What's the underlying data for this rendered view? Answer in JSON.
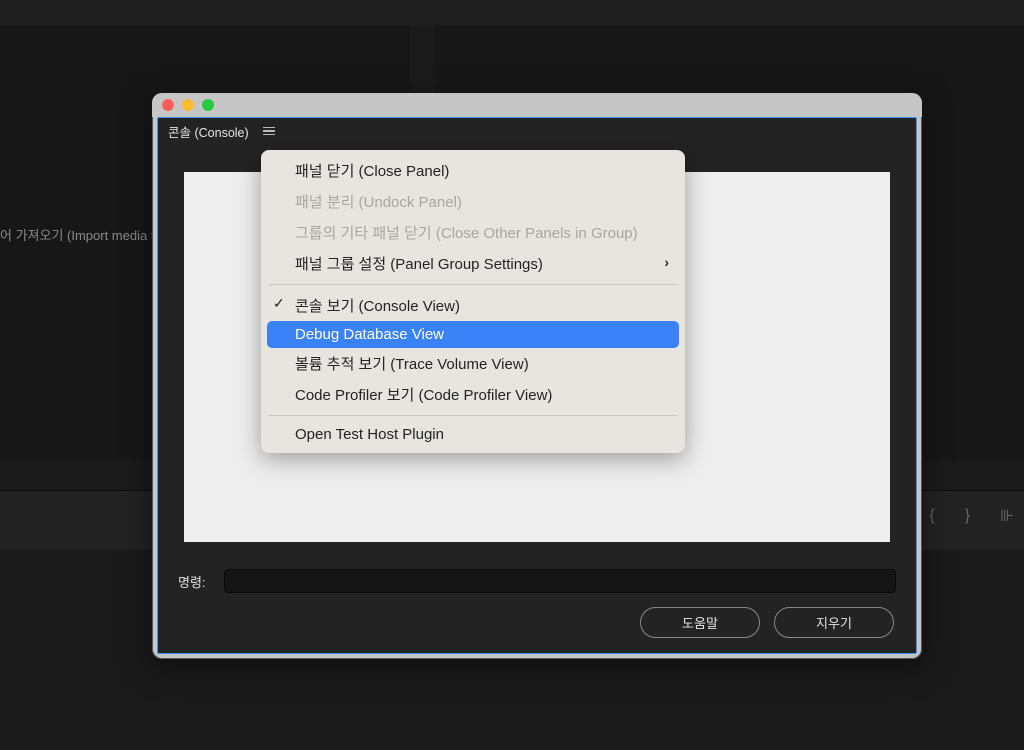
{
  "background": {
    "import_text": "어 가져오기 (Import media to",
    "icons": {
      "brace_open": "{",
      "brace_close": "}",
      "marker": "⊪"
    }
  },
  "window": {
    "tab_title": "콘솔 (Console)",
    "cmd_label": "명령:",
    "buttons": {
      "help": "도움말",
      "clear": "지우기"
    }
  },
  "menu": {
    "items": [
      {
        "id": "close-panel",
        "label": "패널 닫기 (Close Panel)",
        "disabled": false,
        "checked": false,
        "submenu": false,
        "highlight": false
      },
      {
        "id": "undock-panel",
        "label": "패널 분리 (Undock Panel)",
        "disabled": true,
        "checked": false,
        "submenu": false,
        "highlight": false
      },
      {
        "id": "close-other",
        "label": "그룹의 기타 패널 닫기 (Close Other Panels in Group)",
        "disabled": true,
        "checked": false,
        "submenu": false,
        "highlight": false
      },
      {
        "id": "panel-group",
        "label": "패널 그룹 설정 (Panel Group Settings)",
        "disabled": false,
        "checked": false,
        "submenu": true,
        "highlight": false
      },
      {
        "id": "sep1",
        "separator": true
      },
      {
        "id": "console-view",
        "label": "콘솔 보기 (Console View)",
        "disabled": false,
        "checked": true,
        "submenu": false,
        "highlight": false
      },
      {
        "id": "debug-db-view",
        "label": "Debug Database View",
        "disabled": false,
        "checked": false,
        "submenu": false,
        "highlight": true
      },
      {
        "id": "trace-volume-view",
        "label": "볼륨 추적 보기 (Trace Volume View)",
        "disabled": false,
        "checked": false,
        "submenu": false,
        "highlight": false
      },
      {
        "id": "code-profiler-view",
        "label": "Code Profiler 보기 (Code Profiler View)",
        "disabled": false,
        "checked": false,
        "submenu": false,
        "highlight": false
      },
      {
        "id": "sep2",
        "separator": true
      },
      {
        "id": "open-test-host",
        "label": "Open Test Host Plugin",
        "disabled": false,
        "checked": false,
        "submenu": false,
        "highlight": false
      }
    ]
  }
}
